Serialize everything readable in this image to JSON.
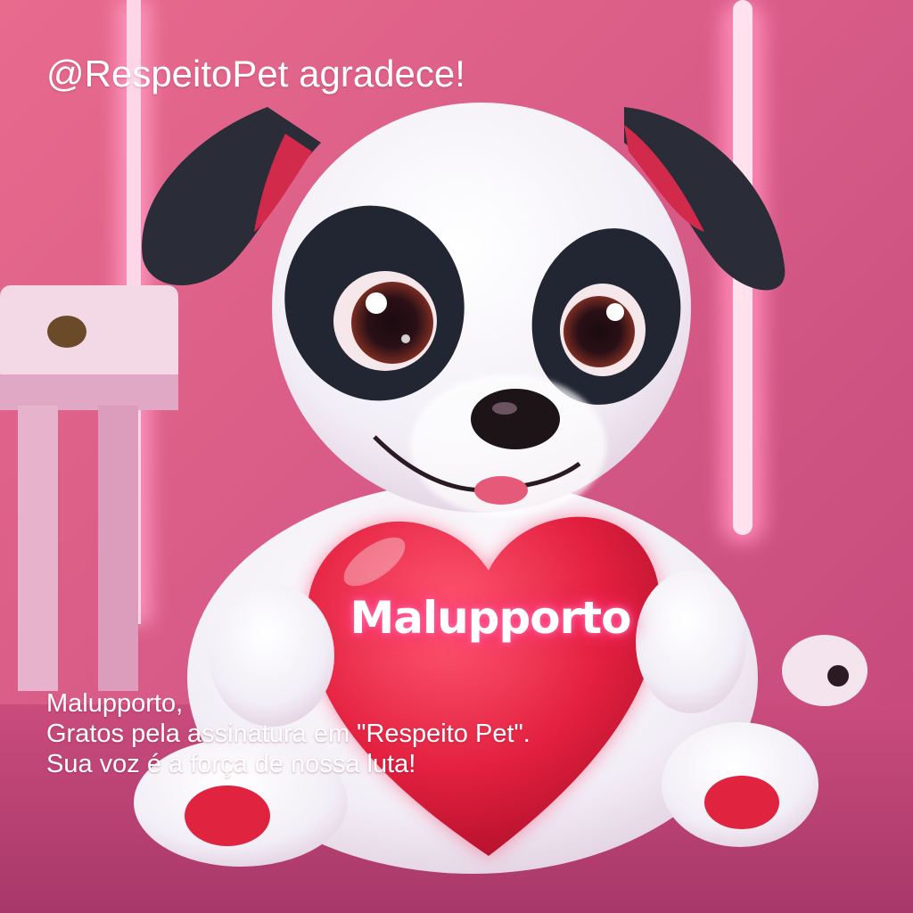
{
  "header": {
    "title": "@RespeitoPet agradece!"
  },
  "heart": {
    "name": "Malupporto"
  },
  "message": {
    "line1": "Malupporto,",
    "line2": "Gratos pela assinatura em \"Respeito Pet\".",
    "line3": "Sua voz é a força de nossa luta!"
  },
  "colors": {
    "background": "#d9567a",
    "neon": "#ff7fb0",
    "heart": "#e8203f",
    "fur": "#f4f4f8",
    "patch": "#222633"
  }
}
